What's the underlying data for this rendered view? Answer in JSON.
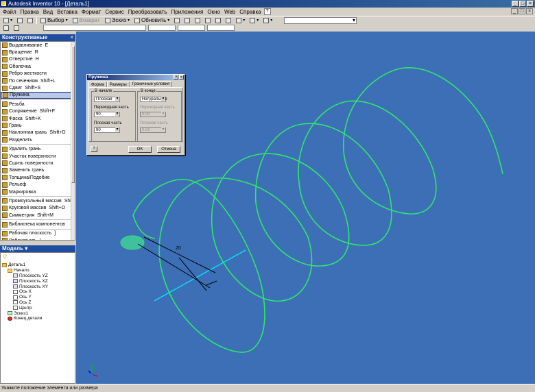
{
  "window": {
    "title": "Autodesk Inventor 10 - [Деталь1]",
    "controls": [
      "_",
      "□",
      "×"
    ]
  },
  "menu": {
    "items": [
      "Файл",
      "Правка",
      "Вид",
      "Вставка",
      "Формат",
      "Сервис",
      "Преобразовать",
      "Приложения",
      "Окно",
      "Web",
      "Справка"
    ],
    "help_icon": "?",
    "mdi_controls": [
      "_",
      "□",
      "×"
    ]
  },
  "toolbar": {
    "select_label": "Выбор",
    "return_label": "Возврат",
    "sketch_label": "Эскиз",
    "update_label": "Обновить"
  },
  "features_panel": {
    "title": "Конструктивные элементы",
    "close": "×",
    "items": [
      {
        "label": "Выдавливание",
        "shortcut": "E"
      },
      {
        "label": "Вращение",
        "shortcut": "R"
      },
      {
        "label": "Отверстие",
        "shortcut": "H"
      },
      {
        "label": "Оболочка",
        "shortcut": ""
      },
      {
        "label": "Ребро жесткости",
        "shortcut": ""
      },
      {
        "label": "По сечениям",
        "shortcut": "Shift+L"
      },
      {
        "label": "Сдвиг",
        "shortcut": "Shift+S"
      },
      {
        "label": "Пружина",
        "shortcut": ""
      },
      {
        "label": "Резьба",
        "shortcut": ""
      },
      {
        "label": "Сопряжение",
        "shortcut": "Shift+F"
      },
      {
        "label": "Фаска",
        "shortcut": "Shift+K"
      },
      {
        "label": "Грань",
        "shortcut": ""
      },
      {
        "label": "Наклонная грань",
        "shortcut": "Shift+D"
      },
      {
        "label": "Разделить",
        "shortcut": ""
      },
      {
        "label": "Удалить грань",
        "shortcut": ""
      },
      {
        "label": "Участок поверхности",
        "shortcut": ""
      },
      {
        "label": "Сшить поверхности",
        "shortcut": ""
      },
      {
        "label": "Заменить грань",
        "shortcut": ""
      },
      {
        "label": "Толщина/Подобие",
        "shortcut": ""
      },
      {
        "label": "Рельеф",
        "shortcut": ""
      },
      {
        "label": "Маркировка",
        "shortcut": ""
      },
      {
        "label": "Прямоугольный массив",
        "shortcut": "Shift+R"
      },
      {
        "label": "Круговой массив",
        "shortcut": "Shift+O"
      },
      {
        "label": "Симметрия",
        "shortcut": "Shift+M"
      },
      {
        "label": "Библиотека компонентов",
        "shortcut": ""
      },
      {
        "label": "Рабочая плоскость",
        "shortcut": "]"
      },
      {
        "label": "Рабочая ось",
        "shortcut": "/"
      }
    ]
  },
  "model_panel": {
    "title": "Модель",
    "items": [
      {
        "label": "Деталь1",
        "indent": 0,
        "icon": "part-icon"
      },
      {
        "label": "Начало",
        "indent": 1,
        "icon": "folder-icon"
      },
      {
        "label": "Плоскость YZ",
        "indent": 2,
        "icon": "plane-icon"
      },
      {
        "label": "Плоскость XZ",
        "indent": 2,
        "icon": "plane-icon"
      },
      {
        "label": "Плоскость XY",
        "indent": 2,
        "icon": "plane-icon"
      },
      {
        "label": "Ось X",
        "indent": 2,
        "icon": "axis-icon"
      },
      {
        "label": "Ось Y",
        "indent": 2,
        "icon": "axis-icon"
      },
      {
        "label": "Ось Z",
        "indent": 2,
        "icon": "axis-icon"
      },
      {
        "label": "Центр",
        "indent": 2,
        "icon": "point-icon"
      },
      {
        "label": "Эскиз1",
        "indent": 1,
        "icon": "sketch-icon"
      },
      {
        "label": "Конец детали",
        "indent": 1,
        "icon": "end-of-part-icon"
      }
    ]
  },
  "coil_dialog": {
    "title": "Пружина",
    "tabs": [
      "Форма",
      "Размеры",
      "Граничные условия"
    ],
    "start_group": "В начале",
    "end_group": "В конце",
    "start_type": "Плоская",
    "end_type": "Натуральная",
    "transition_label": "Переходная часть",
    "flat_label": "Плоская часть",
    "start_transition": "90",
    "start_flat": "90",
    "end_transition": "0.00",
    "end_flat": "0.00",
    "help": "?",
    "ok": "OK",
    "cancel": "Отмена"
  },
  "viewport": {
    "dimension": "20"
  },
  "status": {
    "text": "Укажите положение элемента или размера"
  }
}
